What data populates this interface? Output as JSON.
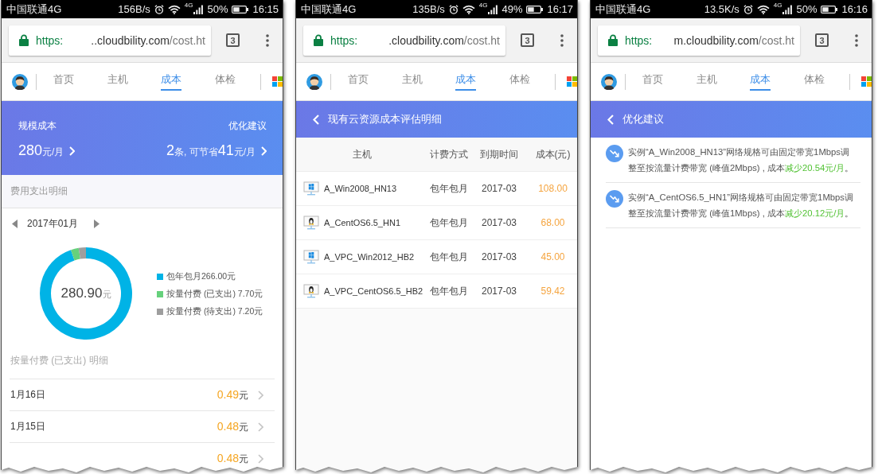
{
  "screens": [
    {
      "kind": "cost_overview",
      "status_bar": {
        "carrier": "中国联通4G",
        "speed": "156B/s",
        "network": "4G",
        "battery": "50%",
        "time": "16:15"
      },
      "browser": {
        "scheme": "https:",
        "host": "..cloudbility.com",
        "path": "/cost.ht",
        "tab_count": "3"
      },
      "nav": {
        "tabs": [
          {
            "label": "首页",
            "selected": false
          },
          {
            "label": "主机",
            "selected": false
          },
          {
            "label": "成本",
            "selected": true
          },
          {
            "label": "体检",
            "selected": false
          }
        ]
      },
      "summary": [
        {
          "label": "规模成本",
          "value": [
            {
              "kind": "number",
              "text": "280"
            },
            {
              "kind": "unit",
              "text": "元/月"
            }
          ]
        },
        {
          "label": "优化建议",
          "value": [
            {
              "kind": "number",
              "text": "2"
            },
            {
              "kind": "unit",
              "text": "条, 可节省"
            },
            {
              "kind": "number",
              "text": "41"
            },
            {
              "kind": "unit",
              "text": "元/月"
            }
          ]
        }
      ],
      "section_title": "费用支出明细",
      "month": "2017年01月",
      "donut": {
        "total": "280.90",
        "unit": "元",
        "legend": [
          {
            "label": "包年包月266.00元",
            "color": "#00b3e6"
          },
          {
            "label": "按量付费 (已支出) 7.70元",
            "color": "#66d17c"
          },
          {
            "label": "按量付费 (待支出) 7.20元",
            "color": "#9e9e9e"
          }
        ],
        "chart_data": {
          "type": "donut",
          "values": [
            94.7,
            2.74,
            2.56
          ]
        }
      },
      "detail_title": "按量付费 (已支出) 明细",
      "rows": [
        {
          "date": "1月16日",
          "amount": "0.49",
          "unit": "元"
        },
        {
          "date": "1月15日",
          "amount": "0.48",
          "unit": "元"
        },
        {
          "amount": "0.48",
          "unit": "元"
        }
      ]
    },
    {
      "kind": "cost_detail",
      "status_bar": {
        "carrier": "中国联通4G",
        "speed": "135B/s",
        "network": "4G",
        "battery": "49%",
        "time": "16:17"
      },
      "browser": {
        "scheme": "https:",
        "host": ".cloudbility.com",
        "path": "/cost.ht",
        "tab_count": "3"
      },
      "nav": {
        "tabs": [
          {
            "label": "首页",
            "selected": false
          },
          {
            "label": "主机",
            "selected": false
          },
          {
            "label": "成本",
            "selected": true
          },
          {
            "label": "体检",
            "selected": false
          }
        ]
      },
      "header": {
        "title": "现有云资源成本评估明细"
      },
      "table": {
        "columns": [
          "主机",
          "计费方式",
          "到期时间",
          "成本(元)"
        ],
        "rows": [
          {
            "kind": "windows",
            "cells": [
              "A_Win2008_HN13",
              "包年包月",
              "2017-03",
              "108.00"
            ]
          },
          {
            "kind": "linux",
            "cells": [
              "A_CentOS6.5_HN1",
              "包年包月",
              "2017-03",
              "68.00"
            ]
          },
          {
            "kind": "windows",
            "cells": [
              "A_VPC_Win2012_HB2",
              "包年包月",
              "2017-03",
              "45.00"
            ]
          },
          {
            "kind": "linux",
            "cells": [
              "A_VPC_CentOS6.5_HB2",
              "包年包月",
              "2017-03",
              "59.42"
            ]
          }
        ]
      }
    },
    {
      "kind": "suggestions",
      "status_bar": {
        "carrier": "中国联通4G",
        "speed": "13.5K/s",
        "network": "4G",
        "battery": "50%",
        "time": "16:16"
      },
      "browser": {
        "scheme": "https:",
        "host": "m.cloudbility.com",
        "path": "/cost.ht",
        "tab_count": "3"
      },
      "nav": {
        "tabs": [
          {
            "label": "首页",
            "selected": false
          },
          {
            "label": "主机",
            "selected": false
          },
          {
            "label": "成本",
            "selected": true
          },
          {
            "label": "体检",
            "selected": false
          }
        ]
      },
      "header": {
        "title": "优化建议"
      },
      "items": [
        {
          "text": "实例“A_Win2008_HN13”网络规格可由固定带宽1Mbps调整至按流量计费带宽 (峰值2Mbps) , 成本",
          "highlight": "减少20.54元/月",
          "end": "。"
        },
        {
          "text": "实例“A_CentOS6.5_HN1”网络规格可由固定带宽1Mbps调整至按流量计费带宽 (峰值1Mbps) , 成本",
          "highlight": "减少20.12元/月",
          "end": "。"
        }
      ]
    }
  ]
}
